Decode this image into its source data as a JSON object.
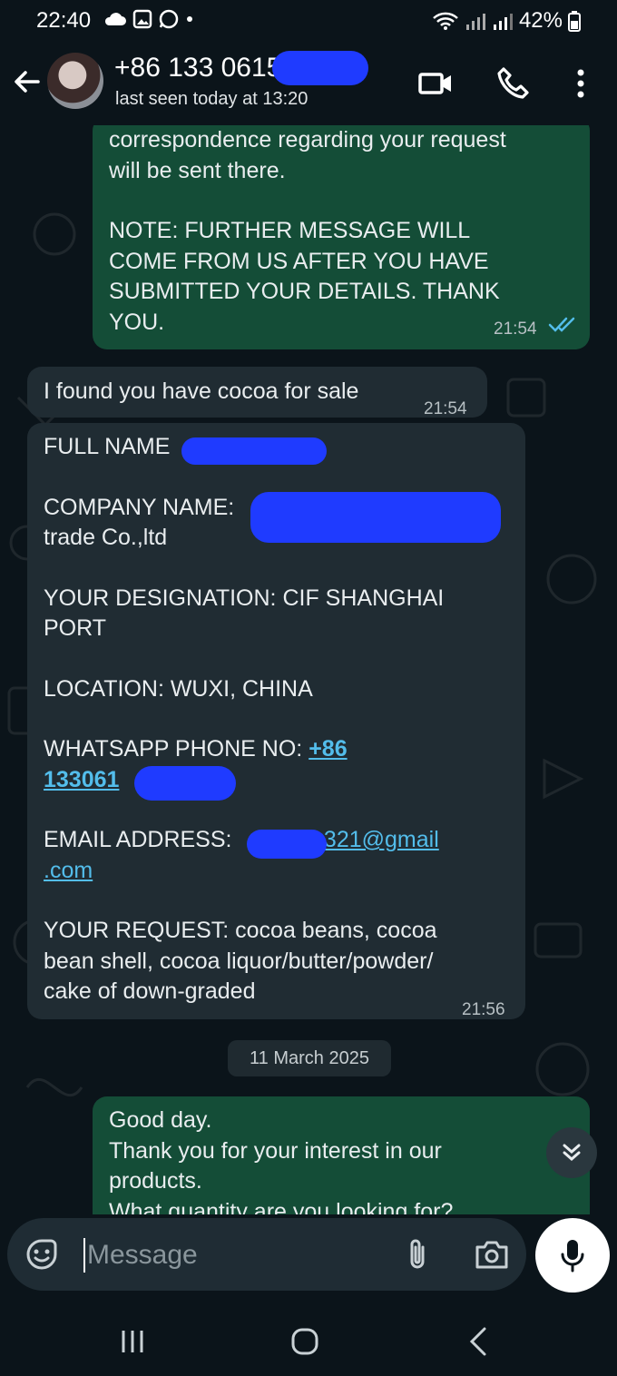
{
  "status": {
    "time": "22:40",
    "battery": "42%"
  },
  "contact": {
    "phone": "+86 133 0615",
    "last_seen": "last seen today at 13:20"
  },
  "messages": [
    {
      "direction": "out",
      "paragraphs": [
        "correspondence regarding your request\nwill be sent there.",
        "NOTE: FURTHER MESSAGE WILL\nCOME FROM US AFTER YOU HAVE\nSUBMITTED YOUR DETAILS. THANK\nYOU."
      ],
      "time": "21:54",
      "status": "read"
    },
    {
      "direction": "in",
      "text": "I found you have cocoa for sale",
      "time": "21:54"
    },
    {
      "direction": "in",
      "full_name_label": "FULL NAME",
      "company_label": "COMPANY NAME:",
      "company_suffix": "trade Co.,ltd",
      "designation": "YOUR DESIGNATION: CIF SHANGHAI\nPORT",
      "location": "LOCATION: WUXI, CHINA",
      "phone_label": "WHATSAPP PHONE NO: ",
      "phone_link_1": "+86",
      "phone_link_2": "133061",
      "email_label": "EMAIL ADDRESS: ",
      "email_link_1": "s321@gmail",
      "email_link_2": ".com",
      "request": "YOUR REQUEST: cocoa beans, cocoa\nbean shell, cocoa liquor/butter/powder/\ncake of down-graded",
      "time": "21:56"
    },
    {
      "direction": "out",
      "text": "Good day.\nThank you for your interest in our\nproducts.\nWhat quantity are you looking for?"
    }
  ],
  "date_divider": "11 March 2025",
  "composer": {
    "placeholder": "Message"
  },
  "colors": {
    "outgoing_bubble": "#144d37",
    "incoming_bubble": "#202c33",
    "link": "#53bdeb",
    "redaction": "#1f3bff"
  },
  "icons": [
    "back-arrow-icon",
    "video-call-icon",
    "phone-icon",
    "more-vertical-icon",
    "sticker-icon",
    "attach-icon",
    "camera-icon",
    "mic-icon",
    "double-check-icon",
    "chevron-double-down-icon"
  ]
}
